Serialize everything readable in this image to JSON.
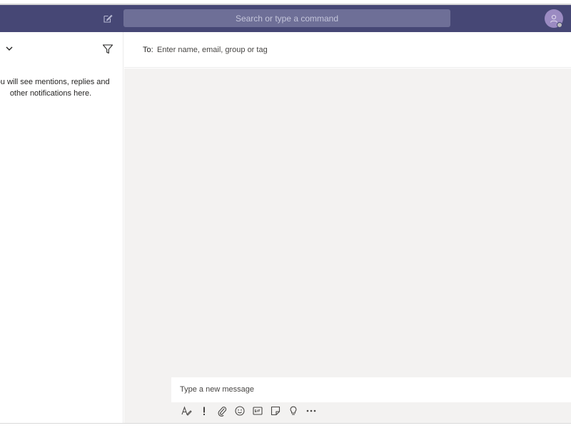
{
  "header": {
    "search_placeholder": "Search or type a command",
    "compose_icon": "new-chat-icon",
    "avatar_icon": "user-avatar-icon"
  },
  "activity": {
    "empty_message": "You will see mentions, replies and other notifications here.",
    "dropdown_icon": "chevron-down-icon",
    "filter_icon": "filter-icon"
  },
  "new_chat": {
    "to_label": "To:",
    "to_placeholder": "Enter name, email, group or tag"
  },
  "composer": {
    "placeholder": "Type a new message",
    "tools": [
      "format-icon",
      "important-icon",
      "attach-icon",
      "emoji-icon",
      "gif-icon",
      "sticker-icon",
      "praise-icon",
      "more-options-icon"
    ]
  },
  "colors": {
    "header": "#464775",
    "search": "#6e6f97",
    "chat_bg": "#f3f2f1"
  }
}
